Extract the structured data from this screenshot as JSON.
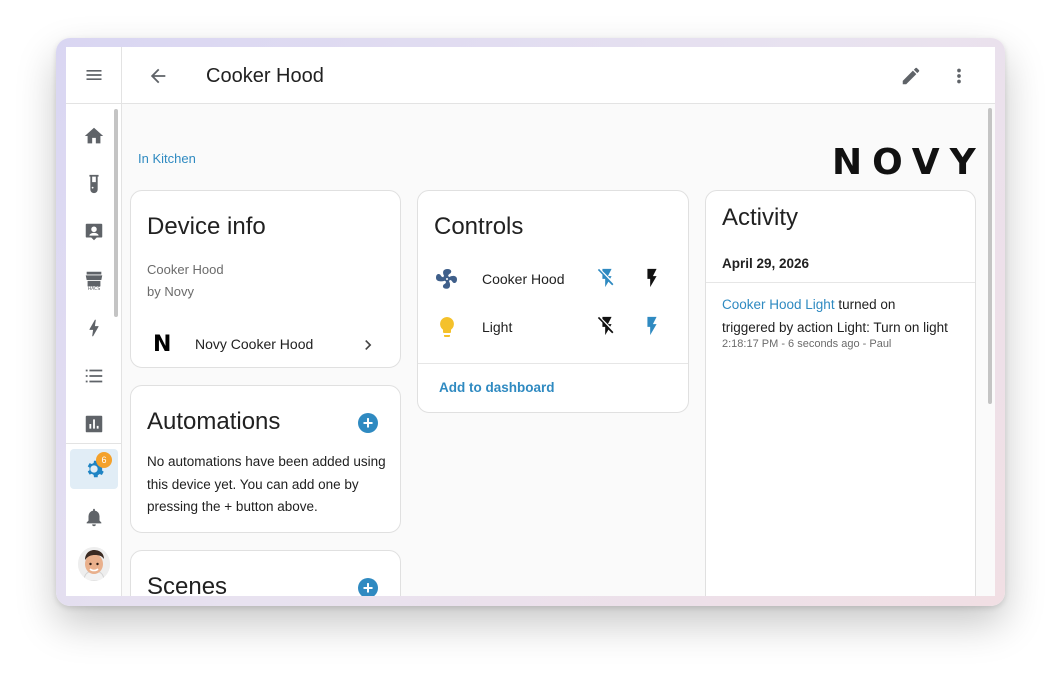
{
  "header": {
    "title": "Cooker Hood",
    "back_icon": "arrow-left-icon",
    "edit_icon": "pencil-icon",
    "more_icon": "dots-vertical-icon"
  },
  "sidebar": {
    "items": [
      {
        "icon": "home-icon"
      },
      {
        "icon": "flask-icon"
      },
      {
        "icon": "account-box-icon"
      },
      {
        "icon": "hacs-store-icon",
        "label": "HACS"
      },
      {
        "icon": "lightning-bolt-icon"
      },
      {
        "icon": "format-list-icon"
      },
      {
        "icon": "chart-box-icon"
      },
      {
        "icon": "cog-icon",
        "badge": "6",
        "active": true
      },
      {
        "icon": "bell-icon"
      }
    ]
  },
  "area_link": "In Kitchen",
  "brand_logo": "NOVY",
  "device_info": {
    "title": "Device info",
    "model": "Cooker Hood",
    "manufacturer": "by Novy",
    "integration_logo": "N",
    "integration_name": "Novy Cooker Hood"
  },
  "automations": {
    "title": "Automations",
    "add_label": "+",
    "empty_text": "No automations have been added using this device yet. You can add one by pressing the + button above."
  },
  "scenes": {
    "title": "Scenes",
    "add_label": "+"
  },
  "controls": {
    "title": "Controls",
    "entities": [
      {
        "name": "Cooker Hood",
        "icon": "fan-icon",
        "icon_color": "#3f5f8a"
      },
      {
        "name": "Light",
        "icon": "lightbulb-icon",
        "icon_color": "#f4c12b"
      }
    ],
    "add_to_dashboard": "Add to dashboard"
  },
  "activity": {
    "title": "Activity",
    "date": "April 29, 2026",
    "entry_entity": "Cooker Hood Light",
    "entry_action": " turned on",
    "entry_trigger": "triggered by action Light: Turn on light",
    "entry_meta": "2:18:17 PM - 6 seconds ago - Paul"
  },
  "colors": {
    "accent": "#2f8ac1",
    "badge": "#f4a12b",
    "fan": "#3f5f8a",
    "bulb": "#f4c12b"
  }
}
